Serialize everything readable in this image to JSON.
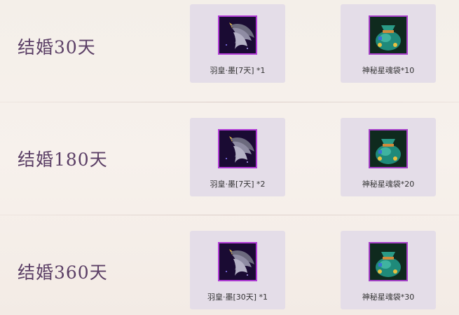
{
  "rows": [
    {
      "title": "结婚30天",
      "rewards": [
        {
          "icon": "wing-icon",
          "label": "羽皇·墨[7天] *1"
        },
        {
          "icon": "soul-bag-icon",
          "label": "神秘星魂袋*10"
        }
      ]
    },
    {
      "title": "结婚180天",
      "rewards": [
        {
          "icon": "wing-icon",
          "label": "羽皇·墨[7天] *2"
        },
        {
          "icon": "soul-bag-icon",
          "label": "神秘星魂袋*20"
        }
      ]
    },
    {
      "title": "结婚360天",
      "rewards": [
        {
          "icon": "wing-icon",
          "label": "羽皇·墨[30天] *1"
        },
        {
          "icon": "soul-bag-icon",
          "label": "神秘星魂袋*30"
        }
      ]
    }
  ],
  "colors": {
    "title": "#5b3f66",
    "card_bg": "#e4dde8",
    "icon_border": "#b13bd6"
  }
}
